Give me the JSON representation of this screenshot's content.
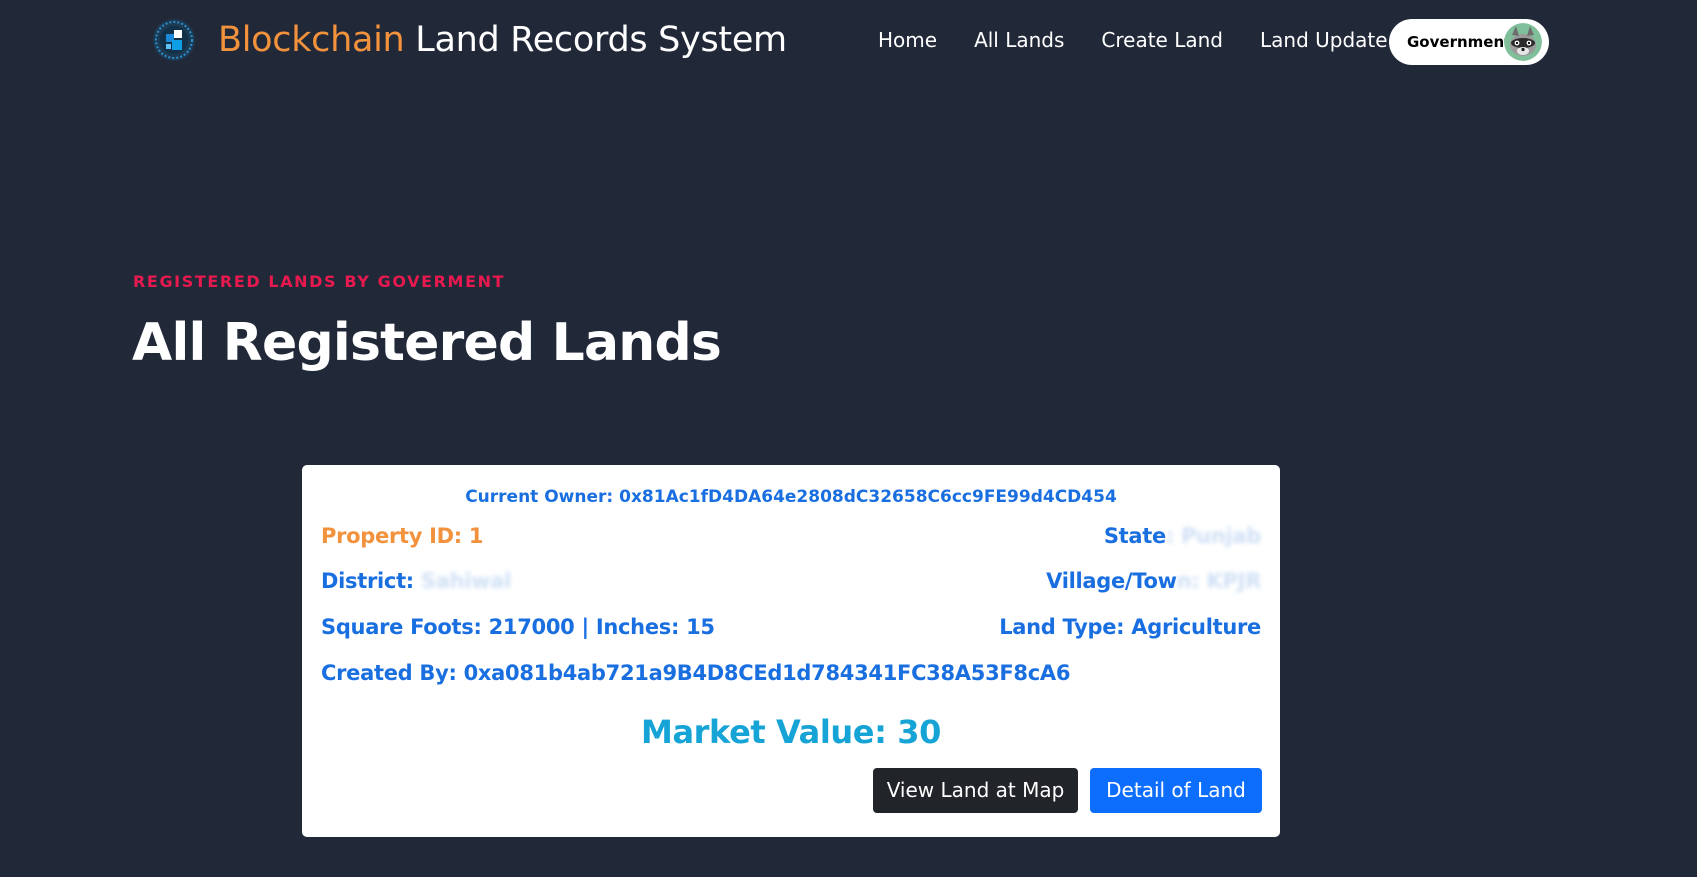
{
  "header": {
    "brand_accent": "Blockchain",
    "brand_rest": " Land Records System",
    "logo_icon": "globe-blockchain-icon",
    "nav": [
      "Home",
      "All Lands",
      "Create Land",
      "Land Update"
    ],
    "account": {
      "name": "Government",
      "avatar_icon": "raccoon-avatar-icon"
    }
  },
  "section": {
    "eyebrow": "REGISTERED LANDS BY GOVERMENT",
    "title": "All Registered Lands"
  },
  "card": {
    "owner_label": "Current Owner: ",
    "owner_address": "0x81Ac1fD4DA64e2808dC32658C6cc9FE99d4CD454",
    "property_id_label": "Property ID: ",
    "property_id": "1",
    "state_label": "State",
    "state_value": ": Punjab",
    "district_label": "District: ",
    "district_value": "Sahiwal",
    "village_label": "Village/Tow",
    "village_value": "n: KPJR",
    "area_label": "Square Foots: ",
    "area_value": "217000",
    "inches_label": " | Inches: ",
    "inches_value": "15",
    "land_type_label": "Land Type: ",
    "land_type_value": "Agriculture",
    "created_by_label": "Created By: ",
    "created_by_address": "0xa081b4ab721a9B4D8CEd1d784341FC38A53F8cA6",
    "market_value_label": "Market Value: ",
    "market_value": "30",
    "buttons": {
      "view_map": "View Land at Map",
      "detail": "Detail of Land"
    }
  },
  "colors": {
    "background": "#212838",
    "accent_orange": "#f3923d",
    "eyebrow_red": "#e8194f",
    "card_blue": "#1a6fe0",
    "market_cyan": "#16a3d6",
    "button_dark": "#212529",
    "button_blue": "#0d6efd"
  }
}
